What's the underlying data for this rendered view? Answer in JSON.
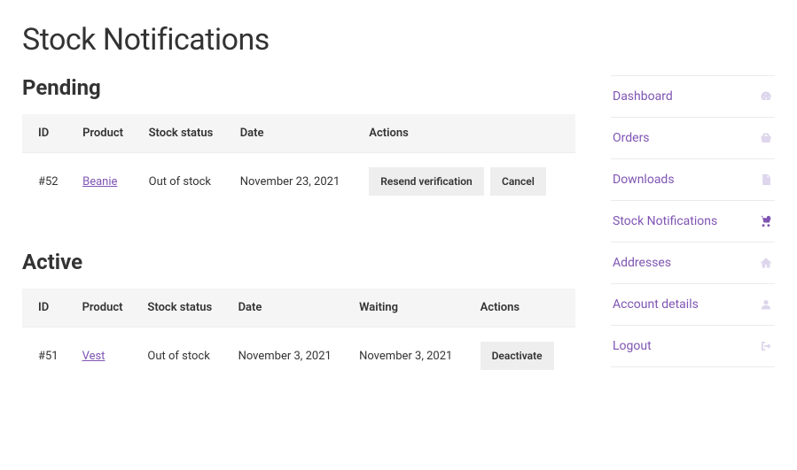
{
  "page_title": "Stock Notifications",
  "sections": {
    "pending": {
      "heading": "Pending",
      "columns": {
        "id": "ID",
        "product": "Product",
        "stock": "Stock status",
        "date": "Date",
        "actions": "Actions"
      },
      "row": {
        "id": "#52",
        "product": "Beanie",
        "stock": "Out of stock",
        "date": "November 23, 2021",
        "actions": {
          "resend": "Resend verification",
          "cancel": "Cancel"
        }
      }
    },
    "active": {
      "heading": "Active",
      "columns": {
        "id": "ID",
        "product": "Product",
        "stock": "Stock status",
        "date": "Date",
        "waiting": "Waiting",
        "actions": "Actions"
      },
      "row": {
        "id": "#51",
        "product": "Vest",
        "stock": "Out of stock",
        "date": "November 3, 2021",
        "waiting": "November 3, 2021",
        "actions": {
          "deactivate": "Deactivate"
        }
      }
    }
  },
  "sidebar": {
    "items": [
      {
        "label": "Dashboard",
        "icon": "dashboard-icon",
        "active": false
      },
      {
        "label": "Orders",
        "icon": "basket-icon",
        "active": false
      },
      {
        "label": "Downloads",
        "icon": "file-icon",
        "active": false
      },
      {
        "label": "Stock Notifications",
        "icon": "cart-bell-icon",
        "active": true
      },
      {
        "label": "Addresses",
        "icon": "home-icon",
        "active": false
      },
      {
        "label": "Account details",
        "icon": "user-icon",
        "active": false
      },
      {
        "label": "Logout",
        "icon": "logout-icon",
        "active": false
      }
    ]
  },
  "colors": {
    "accent": "#7f54b3",
    "muted_icon": "#ddd6ec",
    "button_bg": "#eeeeee",
    "header_bg": "#f5f5f5"
  }
}
